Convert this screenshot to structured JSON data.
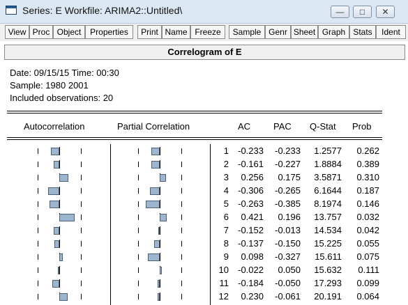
{
  "window": {
    "title": "Series: E    Workfile: ARIMA2::Untitled\\",
    "controls": [
      "minimize",
      "maximize",
      "close"
    ]
  },
  "toolbar": {
    "buttons": [
      "View",
      "Proc",
      "Object",
      "Properties",
      "Print",
      "Name",
      "Freeze",
      "Sample",
      "Genr",
      "Sheet",
      "Graph",
      "Stats",
      "Ident"
    ]
  },
  "view": {
    "title": "Correlogram of E",
    "date_line": "Date: 09/15/15   Time: 00:30",
    "sample_line": "Sample: 1980 2001",
    "obs_line": "Included observations: 20"
  },
  "table": {
    "headers": {
      "autocorrelation": "Autocorrelation",
      "partial": "Partial Correlation",
      "ac": "AC",
      "pac": "PAC",
      "qstat": "Q-Stat",
      "prob": "Prob"
    },
    "rows": [
      {
        "lag": "1",
        "ac": "-0.233",
        "pac": "-0.233",
        "q": "1.2577",
        "prob": "0.262"
      },
      {
        "lag": "2",
        "ac": "-0.161",
        "pac": "-0.227",
        "q": "1.8884",
        "prob": "0.389"
      },
      {
        "lag": "3",
        "ac": "0.256",
        "pac": "0.175",
        "q": "3.5871",
        "prob": "0.310"
      },
      {
        "lag": "4",
        "ac": "-0.306",
        "pac": "-0.265",
        "q": "6.1644",
        "prob": "0.187"
      },
      {
        "lag": "5",
        "ac": "-0.263",
        "pac": "-0.385",
        "q": "8.1974",
        "prob": "0.146"
      },
      {
        "lag": "6",
        "ac": "0.421",
        "pac": "0.196",
        "q": "13.757",
        "prob": "0.032"
      },
      {
        "lag": "7",
        "ac": "-0.152",
        "pac": "-0.013",
        "q": "14.534",
        "prob": "0.042"
      },
      {
        "lag": "8",
        "ac": "-0.137",
        "pac": "-0.150",
        "q": "15.225",
        "prob": "0.055"
      },
      {
        "lag": "9",
        "ac": "0.098",
        "pac": "-0.327",
        "q": "15.611",
        "prob": "0.075"
      },
      {
        "lag": "10",
        "ac": "-0.022",
        "pac": "0.050",
        "q": "15.632",
        "prob": "0.111"
      },
      {
        "lag": "11",
        "ac": "-0.184",
        "pac": "-0.050",
        "q": "17.293",
        "prob": "0.099"
      },
      {
        "lag": "12",
        "ac": "0.230",
        "pac": "-0.061",
        "q": "20.191",
        "prob": "0.064"
      }
    ]
  },
  "colors": {
    "bar_fill": "#9db5cf",
    "titlebar": "#dbe8f4"
  }
}
